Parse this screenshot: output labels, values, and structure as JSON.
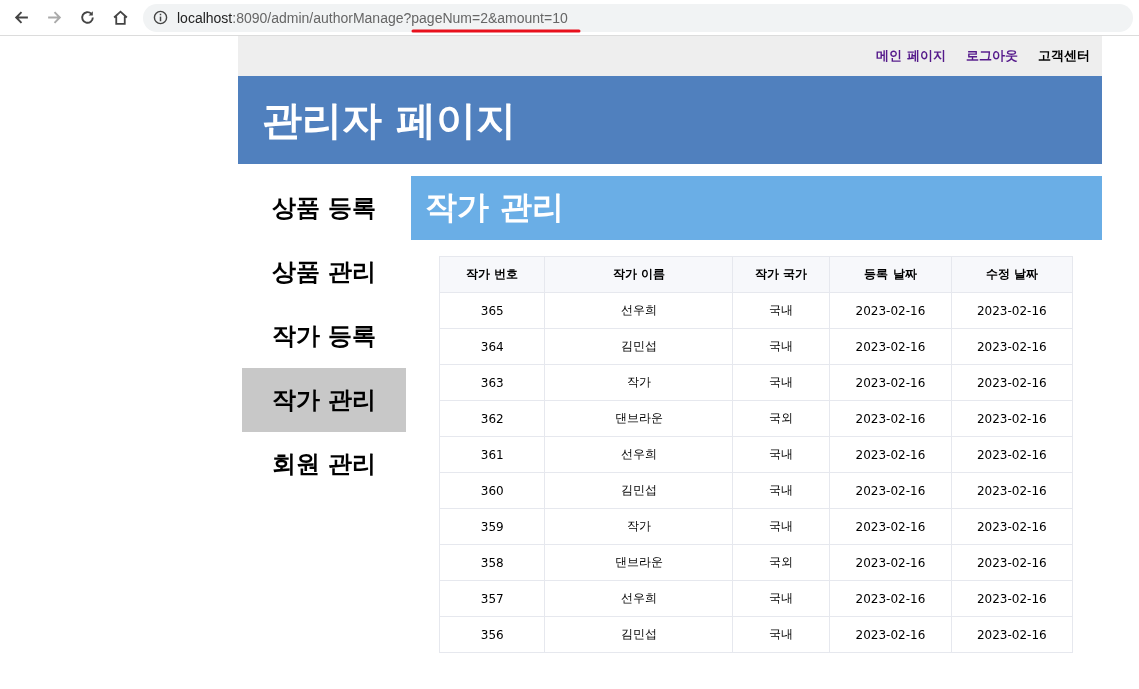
{
  "browser": {
    "url_host": "localhost",
    "url_path": ":8090/admin/authorManage?pageNum=2&amount=10"
  },
  "top_links": [
    {
      "label": "메인 페이지",
      "visited": true
    },
    {
      "label": "로그아웃",
      "visited": true
    },
    {
      "label": "고객센터",
      "visited": false
    }
  ],
  "header": {
    "title": "관리자 페이지"
  },
  "sidebar": {
    "items": [
      {
        "label": "상품 등록",
        "selected": false
      },
      {
        "label": "상품 관리",
        "selected": false
      },
      {
        "label": "작가 등록",
        "selected": false
      },
      {
        "label": "작가 관리",
        "selected": true
      },
      {
        "label": "회원 관리",
        "selected": false
      }
    ]
  },
  "content": {
    "title": "작가 관리"
  },
  "table": {
    "columns": [
      "작가 번호",
      "작가 이름",
      "작가 국가",
      "등록 날짜",
      "수정 날짜"
    ],
    "rows": [
      [
        "365",
        "선우희",
        "국내",
        "2023-02-16",
        "2023-02-16"
      ],
      [
        "364",
        "김민섭",
        "국내",
        "2023-02-16",
        "2023-02-16"
      ],
      [
        "363",
        "작가",
        "국내",
        "2023-02-16",
        "2023-02-16"
      ],
      [
        "362",
        "댄브라운",
        "국외",
        "2023-02-16",
        "2023-02-16"
      ],
      [
        "361",
        "선우희",
        "국내",
        "2023-02-16",
        "2023-02-16"
      ],
      [
        "360",
        "김민섭",
        "국내",
        "2023-02-16",
        "2023-02-16"
      ],
      [
        "359",
        "작가",
        "국내",
        "2023-02-16",
        "2023-02-16"
      ],
      [
        "358",
        "댄브라운",
        "국외",
        "2023-02-16",
        "2023-02-16"
      ],
      [
        "357",
        "선우희",
        "국내",
        "2023-02-16",
        "2023-02-16"
      ],
      [
        "356",
        "김민섭",
        "국내",
        "2023-02-16",
        "2023-02-16"
      ]
    ]
  }
}
